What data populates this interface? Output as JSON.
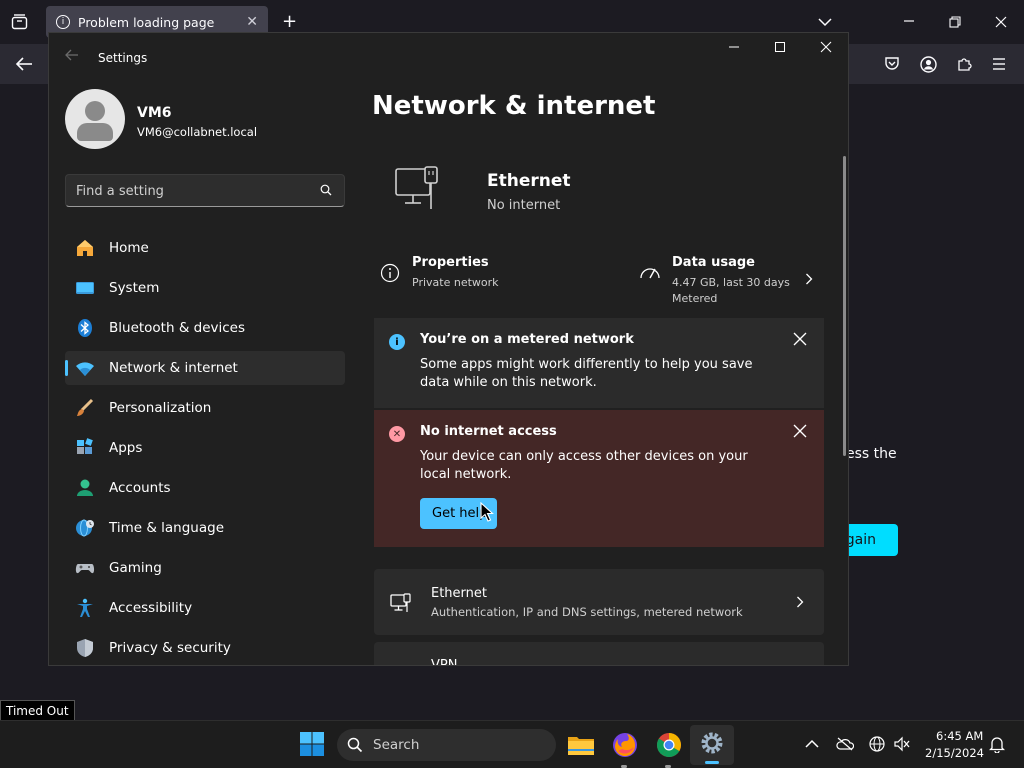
{
  "browser": {
    "tab_title": "Problem loading page",
    "error_text_fragment": "ess the",
    "try_again_fragment": "gain"
  },
  "settings": {
    "window_title": "Settings",
    "user": {
      "name": "VM6",
      "email": "VM6@collabnet.local"
    },
    "search": {
      "placeholder": "Find a setting"
    },
    "nav": [
      {
        "label": "Home",
        "icon": "home-icon"
      },
      {
        "label": "System",
        "icon": "system-icon"
      },
      {
        "label": "Bluetooth & devices",
        "icon": "bluetooth-icon"
      },
      {
        "label": "Network & internet",
        "icon": "wifi-icon",
        "active": true
      },
      {
        "label": "Personalization",
        "icon": "brush-icon"
      },
      {
        "label": "Apps",
        "icon": "apps-icon"
      },
      {
        "label": "Accounts",
        "icon": "accounts-icon"
      },
      {
        "label": "Time & language",
        "icon": "globe-clock-icon"
      },
      {
        "label": "Gaming",
        "icon": "gamepad-icon"
      },
      {
        "label": "Accessibility",
        "icon": "accessibility-icon"
      },
      {
        "label": "Privacy & security",
        "icon": "shield-icon"
      }
    ],
    "page_title": "Network & internet",
    "hero": {
      "name": "Ethernet",
      "status": "No internet"
    },
    "properties": {
      "title": "Properties",
      "subtitle": "Private network"
    },
    "data_usage": {
      "title": "Data usage",
      "line1": "4.47 GB, last 30 days",
      "line2": "Metered"
    },
    "metered_banner": {
      "title": "You’re on a metered network",
      "message": "Some apps might work differently to help you save data while on this network."
    },
    "error_banner": {
      "title": "No internet access",
      "message": "Your device can only access other devices on your local network.",
      "button": "Get help"
    },
    "ethernet_card": {
      "title": "Ethernet",
      "subtitle": "Authentication, IP and DNS settings, metered network"
    },
    "vpn_card": {
      "title": "VPN"
    }
  },
  "tooltip": "Timed Out",
  "taskbar": {
    "search_label": "Search",
    "time": "6:45 AM",
    "date": "2/15/2024"
  },
  "colors": {
    "accent": "#4cc2ff",
    "error_banner_bg": "#442726",
    "browser_accent": "#00ddff"
  }
}
